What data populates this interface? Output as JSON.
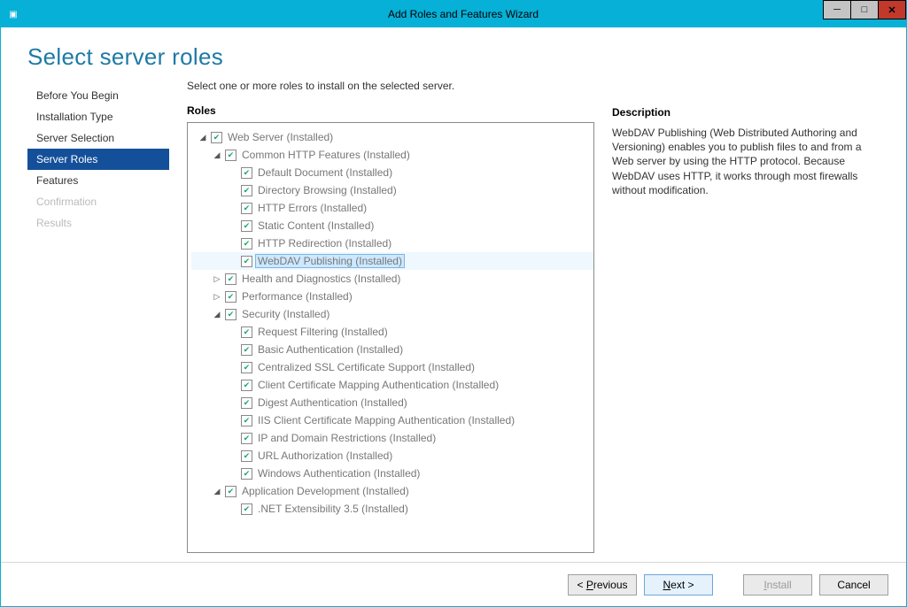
{
  "window": {
    "title": "Add Roles and Features Wizard"
  },
  "page_title": "Select server roles",
  "sidebar": {
    "items": [
      {
        "label": "Before You Begin",
        "state": "normal"
      },
      {
        "label": "Installation Type",
        "state": "normal"
      },
      {
        "label": "Server Selection",
        "state": "normal"
      },
      {
        "label": "Server Roles",
        "state": "selected"
      },
      {
        "label": "Features",
        "state": "normal"
      },
      {
        "label": "Confirmation",
        "state": "disabled"
      },
      {
        "label": "Results",
        "state": "disabled"
      }
    ]
  },
  "instruction": "Select one or more roles to install on the selected server.",
  "roles_heading": "Roles",
  "tree": [
    {
      "indent": 0,
      "expander": "down",
      "checked": true,
      "label": "Web Server (Installed)"
    },
    {
      "indent": 1,
      "expander": "down",
      "checked": true,
      "label": "Common HTTP Features (Installed)"
    },
    {
      "indent": 2,
      "expander": "",
      "checked": true,
      "label": "Default Document (Installed)"
    },
    {
      "indent": 2,
      "expander": "",
      "checked": true,
      "label": "Directory Browsing (Installed)"
    },
    {
      "indent": 2,
      "expander": "",
      "checked": true,
      "label": "HTTP Errors (Installed)"
    },
    {
      "indent": 2,
      "expander": "",
      "checked": true,
      "label": "Static Content (Installed)"
    },
    {
      "indent": 2,
      "expander": "",
      "checked": true,
      "label": "HTTP Redirection (Installed)"
    },
    {
      "indent": 2,
      "expander": "",
      "checked": true,
      "label": "WebDAV Publishing (Installed)",
      "selected": true
    },
    {
      "indent": 1,
      "expander": "right",
      "checked": true,
      "label": "Health and Diagnostics (Installed)"
    },
    {
      "indent": 1,
      "expander": "right",
      "checked": true,
      "label": "Performance (Installed)"
    },
    {
      "indent": 1,
      "expander": "down",
      "checked": true,
      "label": "Security (Installed)"
    },
    {
      "indent": 2,
      "expander": "",
      "checked": true,
      "label": "Request Filtering (Installed)"
    },
    {
      "indent": 2,
      "expander": "",
      "checked": true,
      "label": "Basic Authentication (Installed)"
    },
    {
      "indent": 2,
      "expander": "",
      "checked": true,
      "label": "Centralized SSL Certificate Support (Installed)"
    },
    {
      "indent": 2,
      "expander": "",
      "checked": true,
      "label": "Client Certificate Mapping Authentication (Installed)"
    },
    {
      "indent": 2,
      "expander": "",
      "checked": true,
      "label": "Digest Authentication (Installed)"
    },
    {
      "indent": 2,
      "expander": "",
      "checked": true,
      "label": "IIS Client Certificate Mapping Authentication (Installed)"
    },
    {
      "indent": 2,
      "expander": "",
      "checked": true,
      "label": "IP and Domain Restrictions (Installed)"
    },
    {
      "indent": 2,
      "expander": "",
      "checked": true,
      "label": "URL Authorization (Installed)"
    },
    {
      "indent": 2,
      "expander": "",
      "checked": true,
      "label": "Windows Authentication (Installed)"
    },
    {
      "indent": 1,
      "expander": "down",
      "checked": true,
      "label": "Application Development (Installed)"
    },
    {
      "indent": 2,
      "expander": "",
      "checked": true,
      "label": ".NET Extensibility 3.5 (Installed)"
    }
  ],
  "description": {
    "heading": "Description",
    "body": "WebDAV Publishing (Web Distributed Authoring and Versioning) enables you to publish files to and from a Web server by using the HTTP protocol. Because WebDAV uses HTTP, it works through most firewalls without modification."
  },
  "buttons": {
    "previous": "Previous",
    "next": "Next",
    "install": "Install",
    "cancel": "Cancel"
  }
}
